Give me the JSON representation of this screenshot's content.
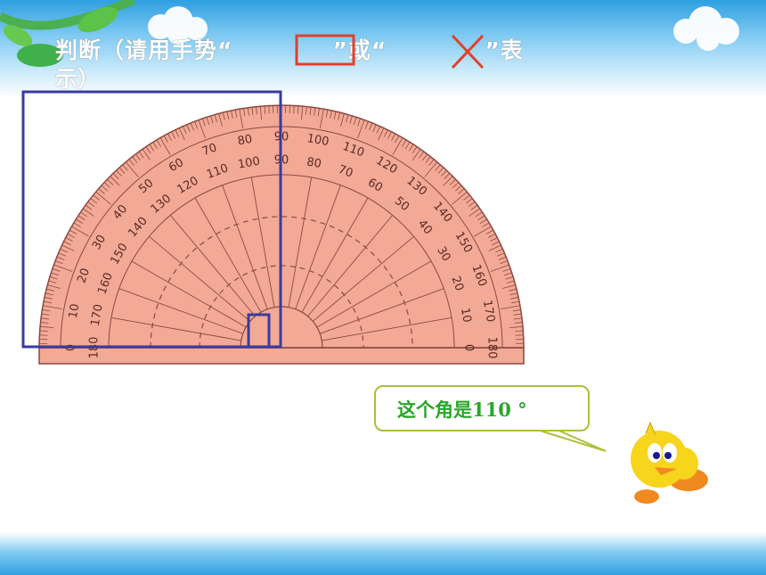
{
  "slide": {
    "title_part1": "判断（请用手势“",
    "title_part2": "”或“",
    "title_part3": "”表",
    "title_wrap": "示）",
    "bubble_text": "这个角是110 °"
  },
  "protractor": {
    "outer_scale": [
      "0",
      "10",
      "20",
      "30",
      "40",
      "50",
      "60",
      "70",
      "80",
      "90",
      "100",
      "110",
      "120",
      "130",
      "140",
      "150",
      "160",
      "170",
      "180"
    ],
    "inner_scale": [
      "180",
      "170",
      "160",
      "150",
      "140",
      "130",
      "120",
      "110",
      "100",
      "90",
      "80",
      "70",
      "60",
      "50",
      "40",
      "30",
      "20",
      "10",
      "0"
    ]
  },
  "colors": {
    "protractor_fill": "#f2a996",
    "protractor_line": "#8a4a42",
    "highlight_box": "#3a3aa0",
    "check_box": "#e0402a",
    "cross": "#e0402a",
    "bubble_border": "#a8c23a",
    "bubble_text": "#2aa62a"
  }
}
